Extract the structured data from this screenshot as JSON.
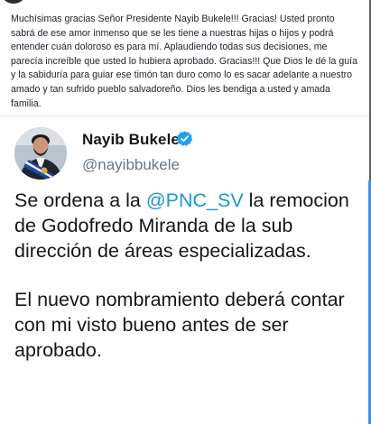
{
  "post": {
    "text": "Muchísimas gracias Señor Presidente Nayib Bukele!!! Gracias! Usted pronto sabrá de ese amor inmenso que se les tiene a nuestras hijas o hijos y podrá entender cuán doloroso es para mí. Aplaudiendo todas sus decisiones, me parecía increíble que usted lo hubiera aprobado. Gracias!!! Que Dios le dé la guía y la sabiduría para guiar ese timón tan duro como lo es sacar adelante a nuestro amado y tan sufrido pueblo salvadoreño. Dios les bendiga a usted y amada familia."
  },
  "tweet": {
    "author_name": "Nayib Bukele",
    "verified_icon": "verified-badge-icon",
    "handle": "@nayibbukele",
    "para1_before": "Se ordena a la ",
    "mention": "@PNC_SV",
    "para1_after": " la remocion de Godofredo Miranda de la sub dirección de áreas especializadas.",
    "para2": "El nuevo nombramiento deberá contar con mi visto bueno antes de ser aprobado."
  },
  "colors": {
    "mention": "#1b95e0",
    "verified": "#1da1f2",
    "handle": "#657786",
    "text": "#14171a"
  }
}
